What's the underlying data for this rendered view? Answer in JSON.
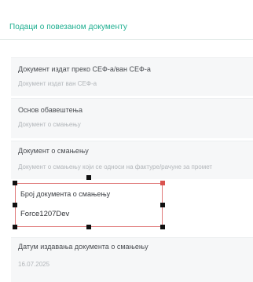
{
  "section": {
    "title": "Подаци о повезаном документу"
  },
  "fields": [
    {
      "label": "Документ издат преко СЕФ-а/ван СЕФ-а",
      "value": "Документ издат ван СЕФ-а"
    },
    {
      "label": "Основ обавештења",
      "value": "Документ о смањењу"
    },
    {
      "label": "Документ о смањењу",
      "value": "Документ о смањењу који се односи на фактуре/рачуне за промет"
    },
    {
      "label": "Број документа о смањењу",
      "value": "Force1207Dev"
    },
    {
      "label": "Датум издавања документа о смањењу",
      "value": "16.07.2025"
    }
  ],
  "colors": {
    "accent": "#1cae8f",
    "selection": "#e07a7a"
  }
}
